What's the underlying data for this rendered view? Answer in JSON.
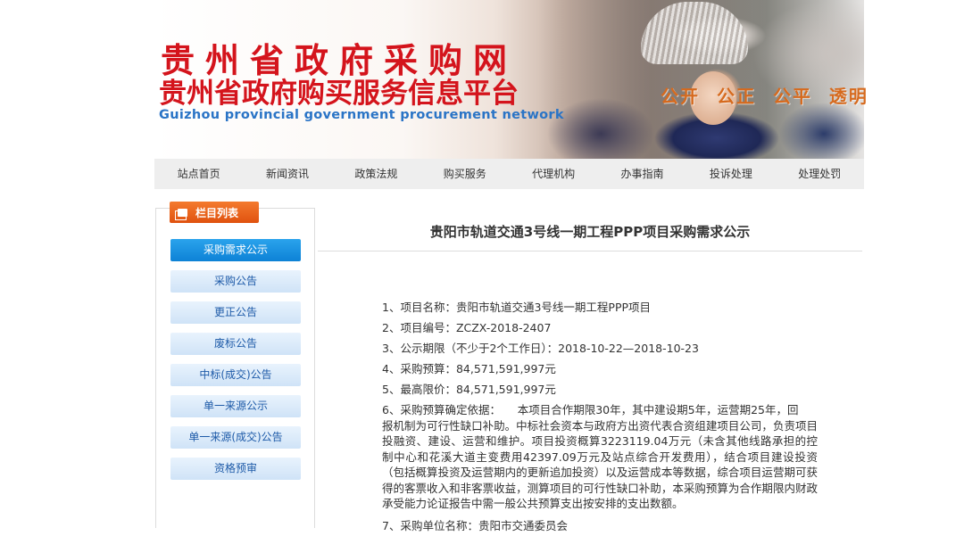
{
  "header": {
    "title_cn_line1": "贵州省政府采购网",
    "title_cn_line2": "贵州省政府购买服务信息平台",
    "title_en": "Guizhou provincial government procurement network",
    "slogan": [
      "公开",
      "公正",
      "公平",
      "透明"
    ]
  },
  "nav": {
    "items": [
      {
        "label": "站点首页"
      },
      {
        "label": "新闻资讯"
      },
      {
        "label": "政策法规"
      },
      {
        "label": "购买服务"
      },
      {
        "label": "代理机构"
      },
      {
        "label": "办事指南"
      },
      {
        "label": "投诉处理"
      },
      {
        "label": "处理处罚"
      }
    ]
  },
  "sidebar": {
    "heading": "栏目列表",
    "items": [
      {
        "label": "采购需求公示"
      },
      {
        "label": "采购公告"
      },
      {
        "label": "更正公告"
      },
      {
        "label": "废标公告"
      },
      {
        "label": "中标(成交)公告"
      },
      {
        "label": "单一来源公示"
      },
      {
        "label": "单一来源(成交)公告"
      },
      {
        "label": "资格预审"
      }
    ]
  },
  "article": {
    "title": "贵阳市轨道交通3号线一期工程PPP项目采购需求公示",
    "lines": [
      "1、项目名称：贵阳市轨道交通3号线一期工程PPP项目",
      "2、项目编号：ZCZX-2018-2407",
      "3、公示期限（不少于2个工作日）：2018-10-22—2018-10-23",
      "4、采购预算：84,571,591,997元",
      "5、最高限价：84,571,591,997元"
    ],
    "para6_first": "6、采购预算确定依据：　　本项目合作期限30年，其中建设期5年，运营期25年，回",
    "para6_rest": "报机制为可行性缺口补助。中标社会资本与政府方出资代表合资组建项目公司，负责项目投融资、建设、运营和维护。项目投资概算3223119.04万元（未含其他线路承担的控制中心和花溪大道主变费用42397.09万元及站点综合开发费用），结合项目建设投资（包括概算投资及运营期内的更新追加投资）以及运营成本等数据，综合项目运营期可获得的客票收入和非客票收益，测算项目的可行性缺口补助，本采购预算为合作期限内财政承受能力论证报告中需一般公共预算支出按安排的支出数额。",
    "line7": "7、采购单位名称：贵阳市交通委员会"
  }
}
